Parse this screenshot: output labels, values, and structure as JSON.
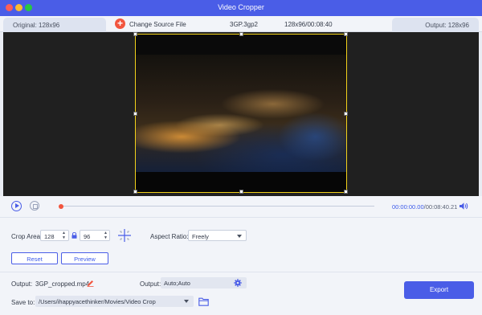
{
  "window": {
    "title": "Video Cropper"
  },
  "info_bar": {
    "original": "Original: 128x96",
    "change_source": "Change Source File",
    "file_name": "3GP.3gp2",
    "file_meta": "128x96/00:08:40",
    "output": "Output: 128x96"
  },
  "player": {
    "current_time": "00:00:00.00",
    "total_time": "/00:08:40.21",
    "progress": 0
  },
  "crop": {
    "label": "Crop Area:",
    "width": "128",
    "height": "96",
    "aspect_label": "Aspect Ratio:",
    "aspect_value": "Freely",
    "reset_label": "Reset",
    "preview_label": "Preview"
  },
  "output": {
    "file_label": "Output:",
    "file_name": "3GP_cropped.mp4",
    "format_label": "Output:",
    "format_value": "Auto;Auto",
    "save_label": "Save to:",
    "save_path": "/Users/ihappyacethinker/Movies/Video Crop",
    "export_label": "Export"
  },
  "colors": {
    "accent": "#4a5de7",
    "crop_frame": "#f2d21b",
    "add_button": "#f2553e"
  },
  "icons": [
    "plus-circle-icon",
    "play-icon",
    "stop-icon",
    "volume-icon",
    "lock-icon",
    "crop-center-icon",
    "edit-icon",
    "gear-icon",
    "folder-icon",
    "chevron-down-icon"
  ]
}
